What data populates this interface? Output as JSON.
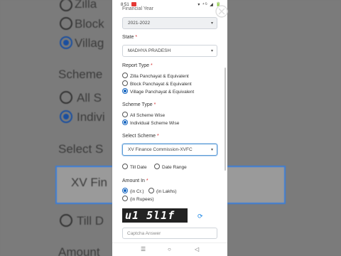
{
  "status_bar": {
    "time": "8:51",
    "signal": "▾ ⁴ᴳ ◢ 🔋"
  },
  "form": {
    "financial_year": {
      "label": "Financial Year",
      "value": "2021-2022"
    },
    "state": {
      "label": "State",
      "required": "*",
      "value": "MADHYA PRADESH"
    },
    "report_type": {
      "label": "Report Type",
      "required": "*",
      "options": [
        "Zilla Panchayat & Equivalent",
        "Block Panchayat & Equivalent",
        "Village Panchayat & Equivalent"
      ]
    },
    "scheme_type": {
      "label": "Scheme Type",
      "required": "*",
      "options": [
        "All Scheme Wise",
        "Individual Scheme Wise"
      ]
    },
    "select_scheme": {
      "label": "Select Scheme",
      "required": "*",
      "value": "XV Finance Commission-XVFC"
    },
    "date_options": [
      "Till Date",
      "Date Range"
    ],
    "amount_in": {
      "label": "Amount In",
      "required": "*",
      "options": [
        "(in Cr.)",
        "(in Lakhs)",
        "(in Rupees)"
      ]
    },
    "captcha": {
      "text": "u1 5l1f",
      "placeholder": "Captcha Answer"
    }
  },
  "background": {
    "left_texts": [
      "Zilla",
      "Block",
      "Villag",
      "Scheme",
      "All S",
      "Indivi",
      "Select S",
      "XV Fin",
      "Till D",
      "Amount"
    ]
  },
  "colors": {
    "accent": "#1565c0",
    "required": "#d32f2f",
    "focus": "#5b9bd5"
  }
}
